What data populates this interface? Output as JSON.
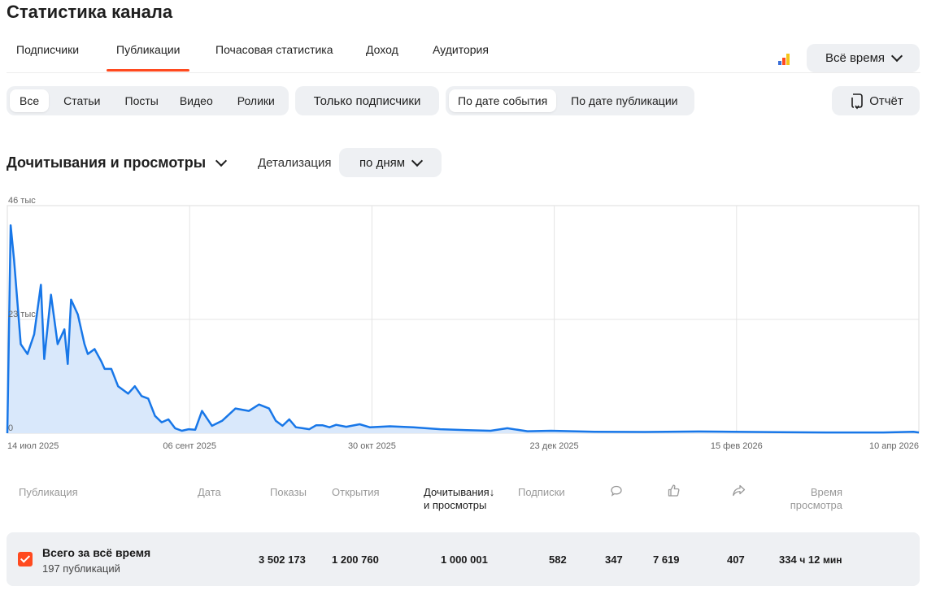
{
  "page": {
    "title": "Статистика канала"
  },
  "tabs": [
    {
      "label": "Подписчики",
      "active": false
    },
    {
      "label": "Публикации",
      "active": true
    },
    {
      "label": "Почасовая статистика",
      "active": false
    },
    {
      "label": "Доход",
      "active": false
    },
    {
      "label": "Аудитория",
      "active": false
    }
  ],
  "period": {
    "label": "Всё время"
  },
  "filters": {
    "types": [
      "Все",
      "Статьи",
      "Посты",
      "Видео",
      "Ролики"
    ],
    "type_selected": "Все",
    "subscribers_only": "Только подписчики",
    "date_modes": [
      "По дате события",
      "По дате публикации"
    ],
    "date_mode_selected": "По дате события",
    "report": "Отчёт"
  },
  "section": {
    "title": "Дочитывания и просмотры",
    "detail_label": "Детализация",
    "detail_value": "по дням"
  },
  "colors": {
    "accent": "#ff4a1f",
    "line": "#1877e8",
    "fill": "#d9e8fb"
  },
  "chart_data": {
    "type": "area",
    "ylim": [
      0,
      46000
    ],
    "yticks": [
      "0",
      "23 тыс",
      "46 тыс"
    ],
    "xticks": [
      "14 июл 2025",
      "06 сент 2025",
      "30 окт 2025",
      "23 дек 2025",
      "15 фев 2026",
      "10 апр 2026"
    ],
    "grid": true,
    "x": [
      "2025-07-08",
      "2025-07-12",
      "2025-07-15",
      "2025-07-16",
      "2025-07-18",
      "2025-07-20",
      "2025-07-22",
      "2025-07-24",
      "2025-07-25",
      "2025-07-27",
      "2025-07-29",
      "2025-07-31",
      "2025-08-01",
      "2025-08-02",
      "2025-08-04",
      "2025-08-06",
      "2025-08-07",
      "2025-08-09",
      "2025-08-11",
      "2025-08-12",
      "2025-08-14",
      "2025-08-16",
      "2025-08-18",
      "2025-08-19",
      "2025-08-21",
      "2025-08-23",
      "2025-08-25",
      "2025-08-27",
      "2025-08-29",
      "2025-08-31",
      "2025-09-02",
      "2025-09-04",
      "2025-09-06",
      "2025-09-08",
      "2025-09-10",
      "2025-09-13",
      "2025-09-16",
      "2025-09-20",
      "2025-09-24",
      "2025-09-27",
      "2025-09-30",
      "2025-10-02",
      "2025-10-04",
      "2025-10-06",
      "2025-10-08",
      "2025-10-10",
      "2025-10-12",
      "2025-10-14",
      "2025-10-16",
      "2025-10-18",
      "2025-10-20",
      "2025-10-23",
      "2025-10-27",
      "2025-10-30",
      "2025-11-05",
      "2025-11-12",
      "2025-11-20",
      "2025-11-28",
      "2025-12-05",
      "2025-12-10",
      "2025-12-16",
      "2025-12-23",
      "2026-01-05",
      "2026-01-20",
      "2026-02-05",
      "2026-02-15",
      "2026-03-01",
      "2026-03-15",
      "2026-04-01",
      "2026-04-10",
      "2026-04-12"
    ],
    "series": [
      {
        "values": [
          0,
          0,
          42000,
          35000,
          18000,
          16000,
          20000,
          30000,
          15000,
          28000,
          18000,
          21000,
          14000,
          27000,
          24000,
          18000,
          16000,
          17000,
          14500,
          13000,
          13000,
          9500,
          8500,
          8000,
          9500,
          7500,
          7000,
          3500,
          2200,
          2800,
          1000,
          500,
          800,
          700,
          4500,
          1500,
          2500,
          5000,
          4500,
          5800,
          5000,
          2500,
          1500,
          2800,
          1200,
          1000,
          800,
          1600,
          1600,
          1200,
          1700,
          1300,
          1800,
          1200,
          1400,
          1200,
          800,
          600,
          500,
          1000,
          400,
          500,
          300,
          250,
          350,
          300,
          200,
          150,
          150,
          300,
          150
        ]
      }
    ]
  },
  "table": {
    "headers": {
      "publication": "Публикация",
      "date": "Дата",
      "shows": "Показы",
      "opens": "Открытия",
      "reads_line1": "Дочитывания",
      "reads_arrow": "↓",
      "reads_line2": "и просмотры",
      "subs": "Подписки",
      "comments_icon": "comment-icon",
      "likes_icon": "like-icon",
      "shares_icon": "share-icon",
      "time_line1": "Время",
      "time_line2": "просмотра"
    },
    "total": {
      "title": "Всего за всё время",
      "subtitle": "197 публикаций",
      "shows": "3 502 173",
      "opens": "1 200 760",
      "reads": "1 000 001",
      "subs": "582",
      "comments": "347",
      "likes": "7 619",
      "shares": "407",
      "time_h": "334",
      "time_h_unit": "ч",
      "time_m": "12",
      "time_m_unit": "мин"
    }
  }
}
